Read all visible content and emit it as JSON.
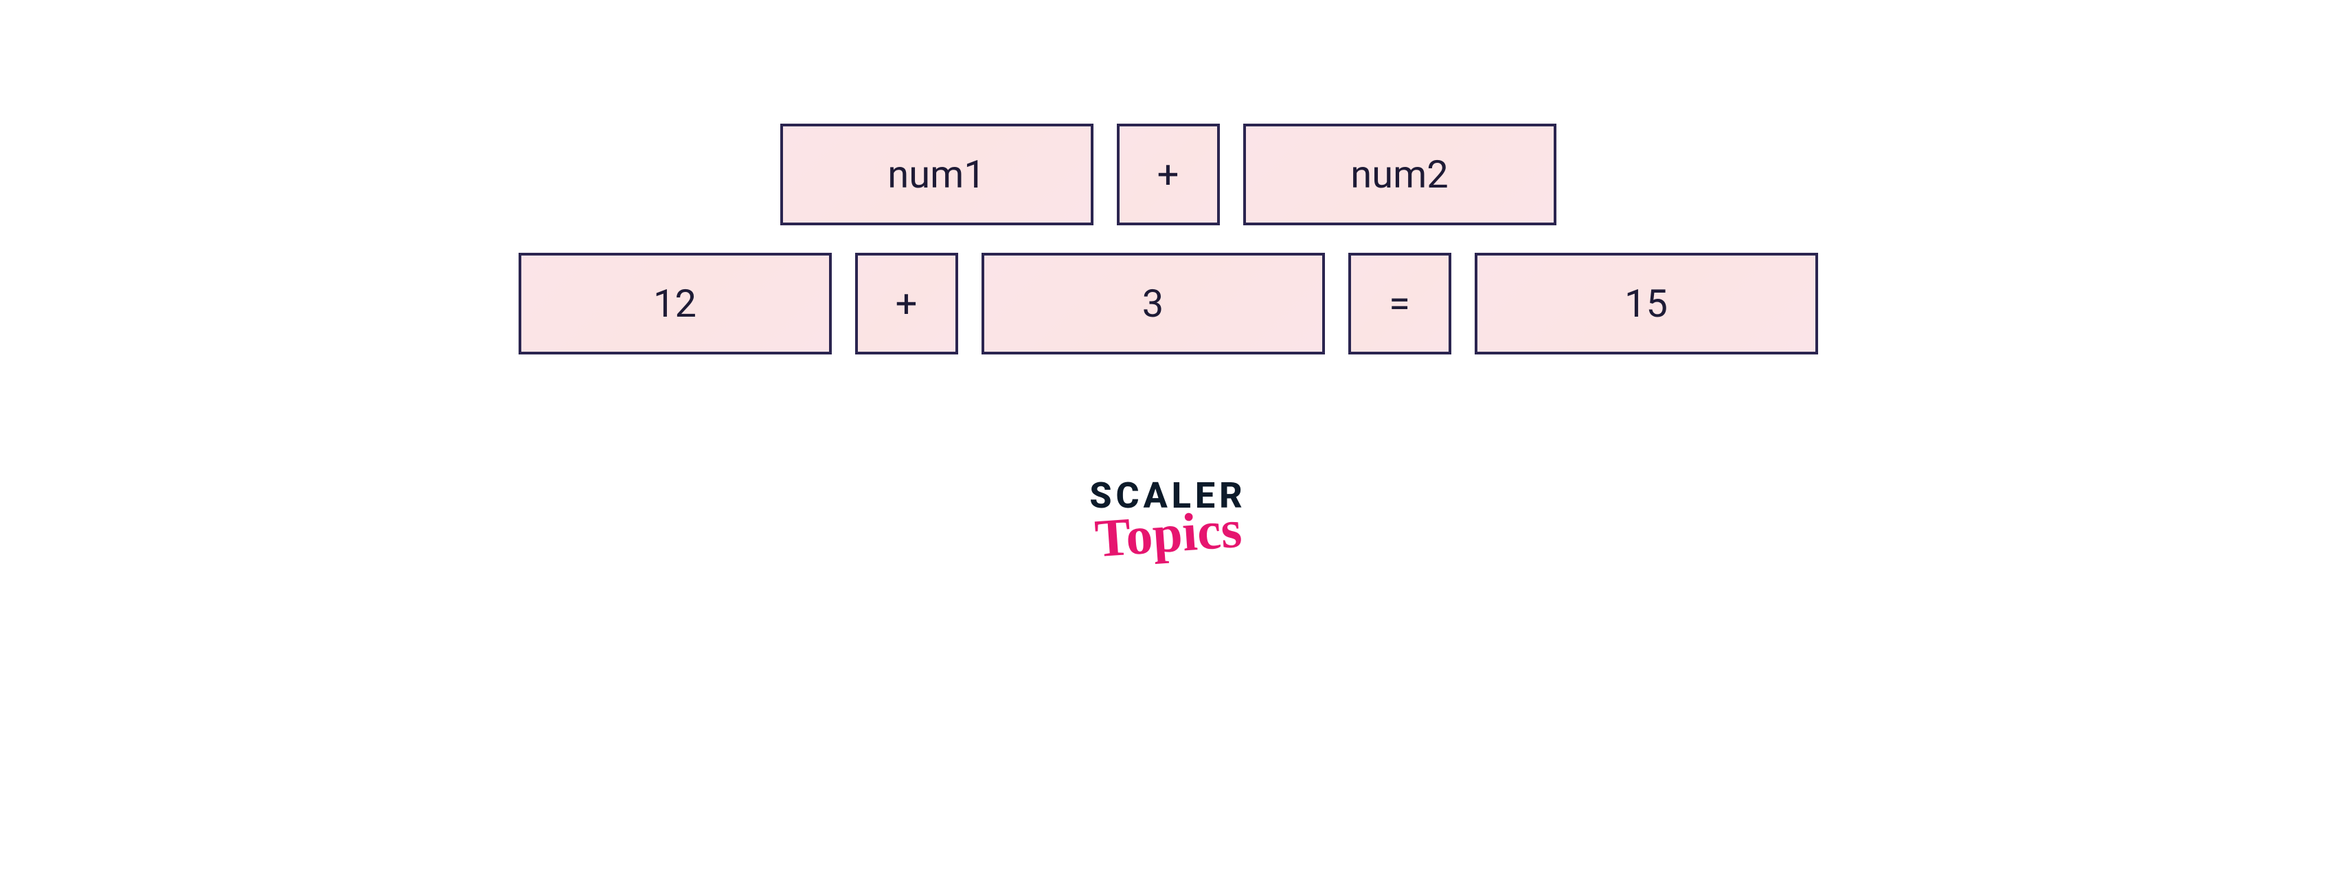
{
  "diagram": {
    "row1": {
      "operand1": "num1",
      "operator": "+",
      "operand2": "num2"
    },
    "row2": {
      "operand1": "12",
      "operator": "+",
      "operand2": "3",
      "equals": "=",
      "result": "15"
    }
  },
  "brand": {
    "line1": "SCALER",
    "line2": "Topics"
  },
  "colors": {
    "cell_bg": "#fbe4e8",
    "cell_border": "#2b2550",
    "text": "#1e1b36",
    "brand_dark": "#0d1b2a",
    "brand_accent": "#e6156f"
  }
}
